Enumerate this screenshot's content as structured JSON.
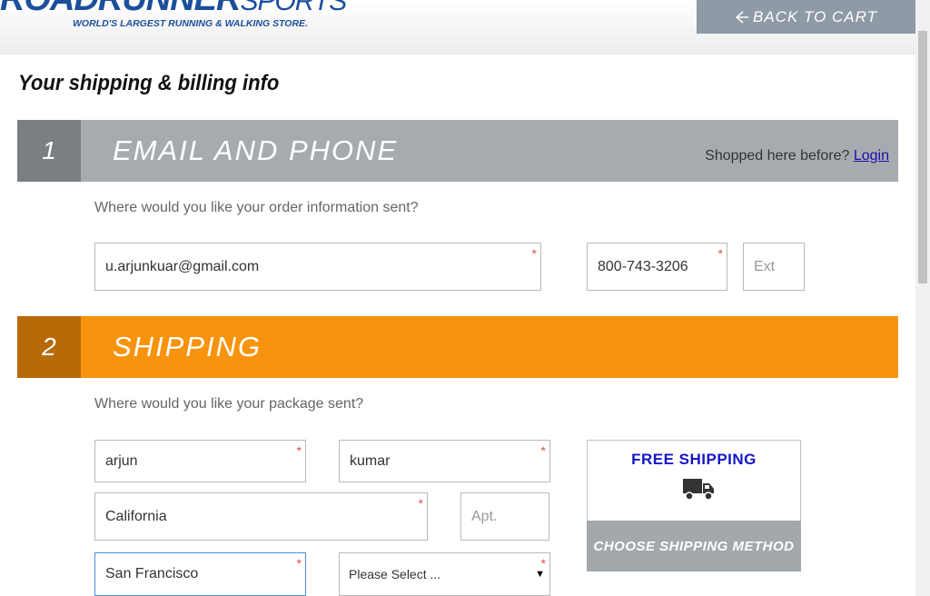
{
  "header": {
    "logo_main": "ROADRUNNER",
    "logo_sub": "SPORTS",
    "tagline": "WORLD'S LARGEST RUNNING & WALKING STORE.",
    "back_label": "BACK TO CART"
  },
  "page_title": "Your shipping & billing info",
  "section1": {
    "number": "1",
    "title": "EMAIL AND PHONE",
    "shopped_text": "Shopped here before?",
    "login_label": "Login",
    "prompt": "Where would you like your order information sent?",
    "email_value": "u.arjunkuar@gmail.com",
    "phone_value": "800-743-3206",
    "ext_placeholder": "Ext"
  },
  "section2": {
    "number": "2",
    "title": "SHIPPING",
    "prompt": "Where would you like your package sent?",
    "first_name_value": "arjun",
    "last_name_value": "kumar",
    "address_value": "California",
    "apt_placeholder": "Apt.",
    "city_value": "San Francisco",
    "state_selected": "Please Select ...",
    "free_shipping_label": "FREE SHIPPING",
    "choose_method_label": "CHOOSE SHIPPING METHOD"
  },
  "required_mark": "*",
  "colors": {
    "section1_bar": "#a6abb0",
    "section1_number": "#7b7f83",
    "section2_bar": "#f7930c",
    "section2_number": "#b86a08",
    "brand_blue": "#1b4f9c",
    "free_shipping_blue": "#1515c6"
  },
  "icons": [
    "arrow-left-icon",
    "truck-icon",
    "chevron-down-icon"
  ]
}
